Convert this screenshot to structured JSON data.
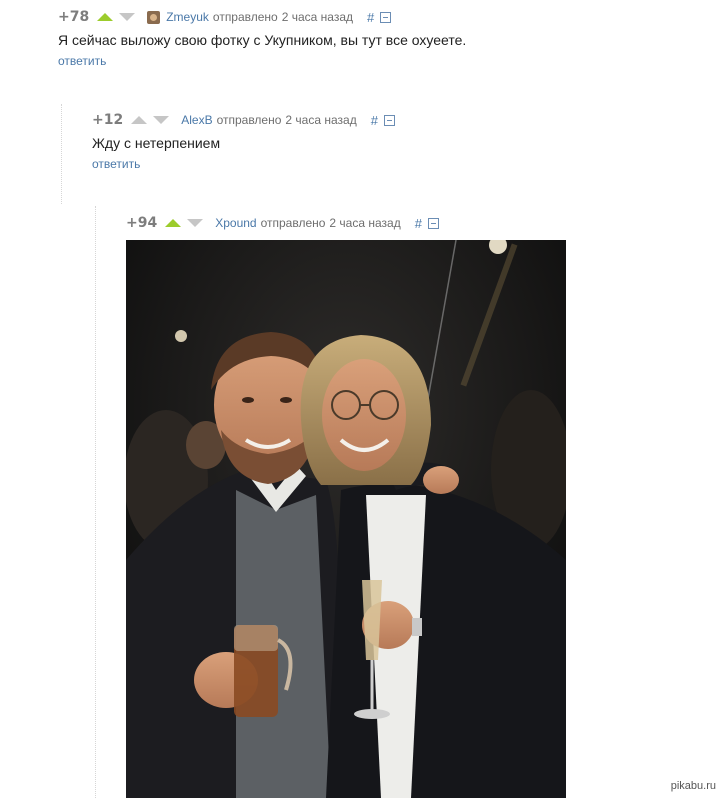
{
  "comments": [
    {
      "rating": "+78",
      "author": "Zmeyuk",
      "posted": "отправлено",
      "time": "2 часа назад",
      "hash": "#",
      "text": "Я сейчас выложу свою фотку с Укупником, вы тут все охуеете.",
      "reply": "ответить"
    },
    {
      "rating": "+12",
      "author": "AlexB",
      "posted": "отправлено",
      "time": "2 часа назад",
      "hash": "#",
      "text": "Жду с нетерпением",
      "reply": "ответить"
    },
    {
      "rating": "+94",
      "author": "Xpound",
      "posted": "отправлено",
      "time": "2 часа назад",
      "hash": "#"
    }
  ],
  "watermark": "pikabu.ru",
  "colors": {
    "link": "#4a78a8",
    "vote_active": "#9ccc2c",
    "vote_inactive": "#c6c6c6",
    "rating": "#7d7d7d"
  },
  "icons": [
    "vote-up-icon",
    "vote-down-icon",
    "avatar-icon",
    "collapse-icon"
  ]
}
